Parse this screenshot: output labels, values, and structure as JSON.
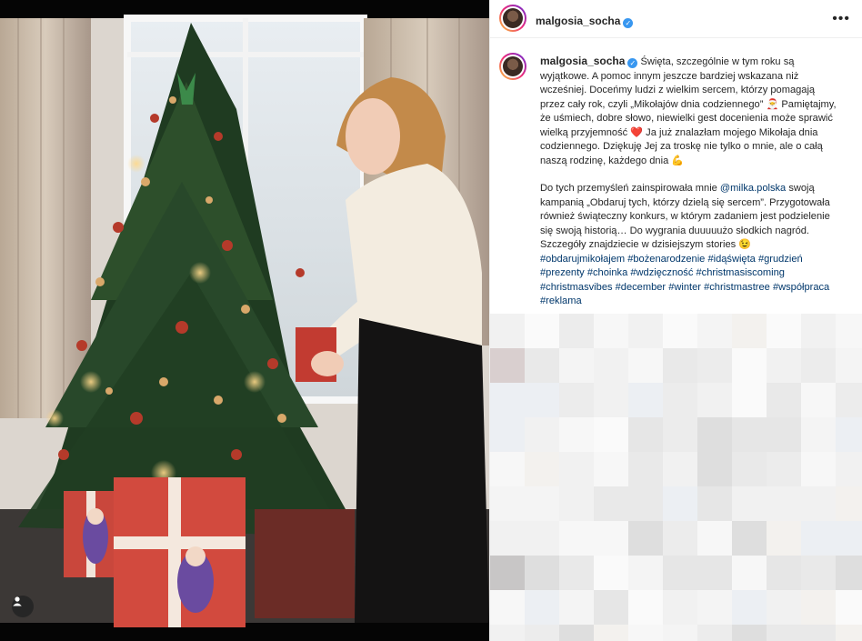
{
  "post": {
    "username": "malgosia_socha",
    "more_icon": "more-options-icon",
    "caption": {
      "p1_intro": "Święta, szczególnie w tym roku są wyjątkowe. A pomoc innym jeszcze bardziej wskazana niż wcześniej. Doceńmy ludzi z wielkim sercem, którzy pomagają przez cały rok, czyli „Mikołajów dnia codziennego” ",
      "p1_mid": " Pamiętajmy, że uśmiech, dobre słowo, niewielki gest docenienia może sprawić wielką przyjemność ",
      "p1_mid2": " Ja już znalazłam mojego Mikołaja dnia codziennego. Dziękuję Jej za troskę nie tylko o mnie, ale o całą naszą rodzinę, każdego dnia ",
      "p2_a": "Do tych przemyśleń zainspirowała mnie ",
      "mention": "@milka.polska",
      "p2_b": " swoją kampanią „Obdaruj tych, którzy dzielą się sercem”. Przygotowała również świąteczny konkurs, w którym zadaniem jest podzielenie się swoją historią… Do wygrania duuuuużo słodkich nagród. Szczegóły znajdziecie w dzisiejszym stories ",
      "hashtags": [
        "#obdarujmikołajem",
        "#bożenarodzenie",
        "#idąświęta",
        "#grudzień",
        "#prezenty",
        "#choinka",
        "#wdzięczność",
        "#christmasiscoming",
        "#christmasvibes",
        "#december",
        "#winter",
        "#christmastree",
        "#współpraca",
        "#reklama"
      ]
    },
    "emoji": {
      "santa": "🎅",
      "heart": "❤️",
      "muscle": "💪",
      "wink": "😉"
    }
  },
  "icons": {
    "user_tag": "user-tag-icon",
    "verified": "verified-badge-icon"
  },
  "colors": {
    "accent_link": "#00376b",
    "verified": "#3897f0"
  }
}
